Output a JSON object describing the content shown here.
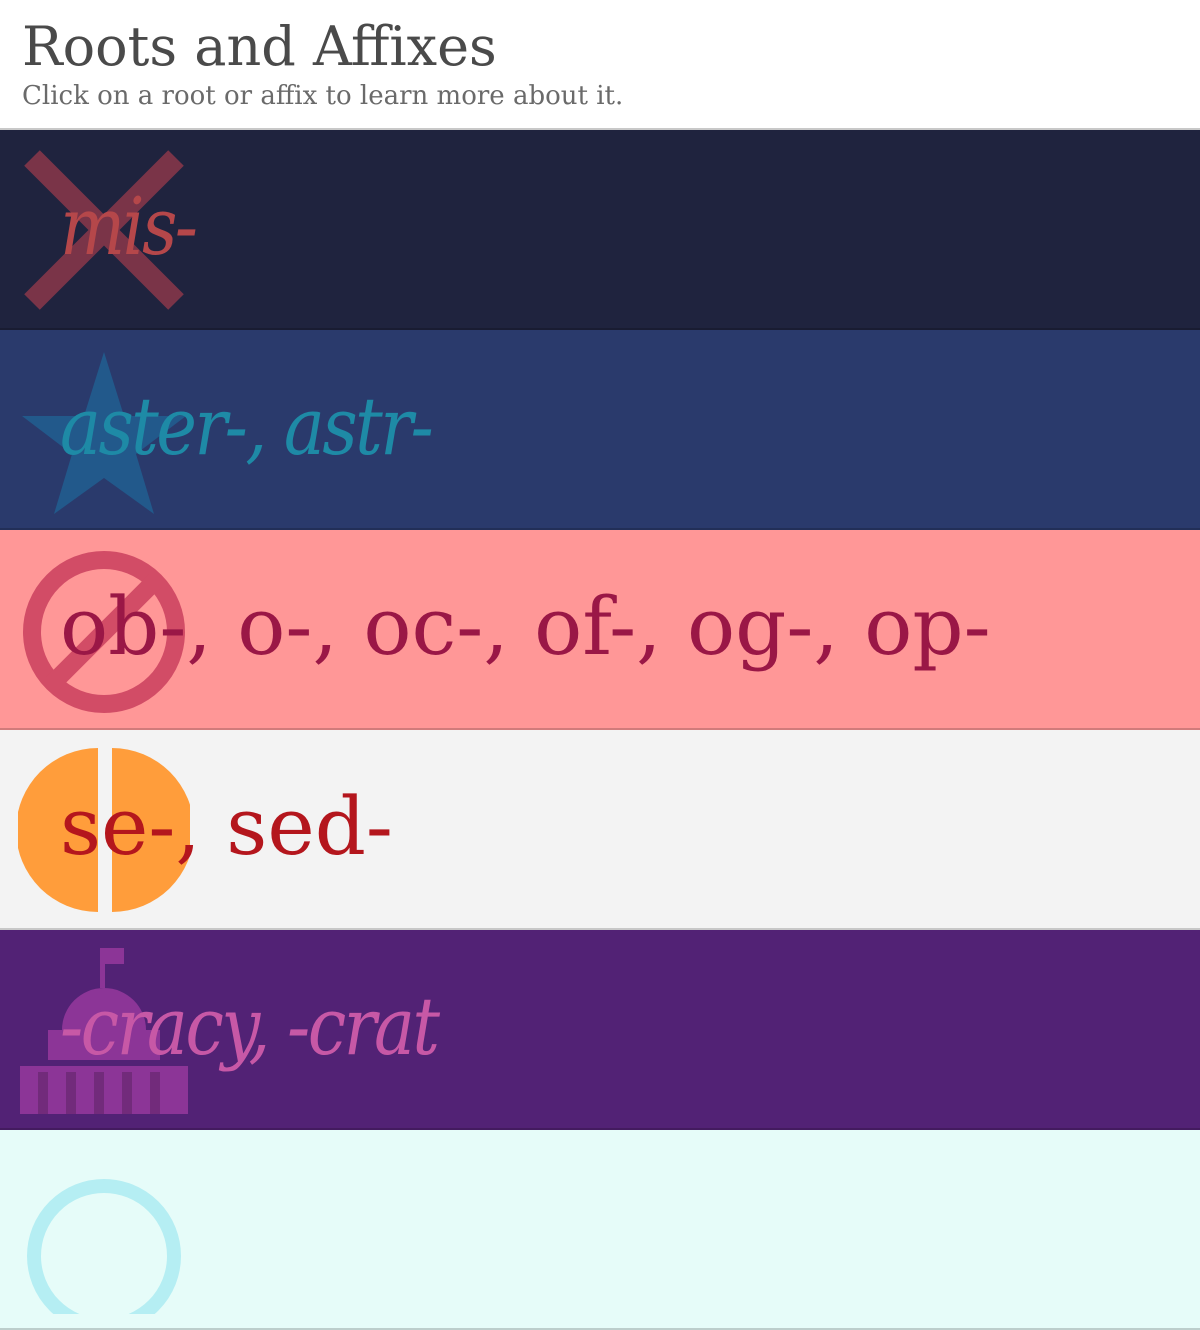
{
  "header": {
    "title": "Roots and Affixes",
    "subtitle": "Click on a root or affix to learn more about it."
  },
  "items": [
    {
      "label": "mis-",
      "background": "#1f233e",
      "text_color": "#b5474a",
      "icon_color": "#7a3448",
      "icon": "x-mark-icon"
    },
    {
      "label": "aster-, astr-",
      "background": "#2a3a6c",
      "text_color": "#1e8aa6",
      "icon_color": "#22598b",
      "icon": "star-icon"
    },
    {
      "label": "ob-, o-, oc-, of-, og-, op-",
      "background": "#ff9797",
      "text_color": "#9a1746",
      "icon_color": "#d24c66",
      "icon": "prohibited-icon"
    },
    {
      "label": "se-, sed-",
      "background": "#f3f3f3",
      "text_color": "#b4161d",
      "icon_color": "#ff9d3b",
      "icon": "split-circle-icon"
    },
    {
      "label": "-cracy, -crat",
      "background": "#522275",
      "text_color": "#c758a6",
      "icon_color": "#8c3597",
      "icon": "capitol-building-icon"
    },
    {
      "label": "",
      "background": "#e6fcf9",
      "text_color": "#2a9fb0",
      "icon_color": "#b5eef3",
      "icon": "ring-icon"
    }
  ]
}
